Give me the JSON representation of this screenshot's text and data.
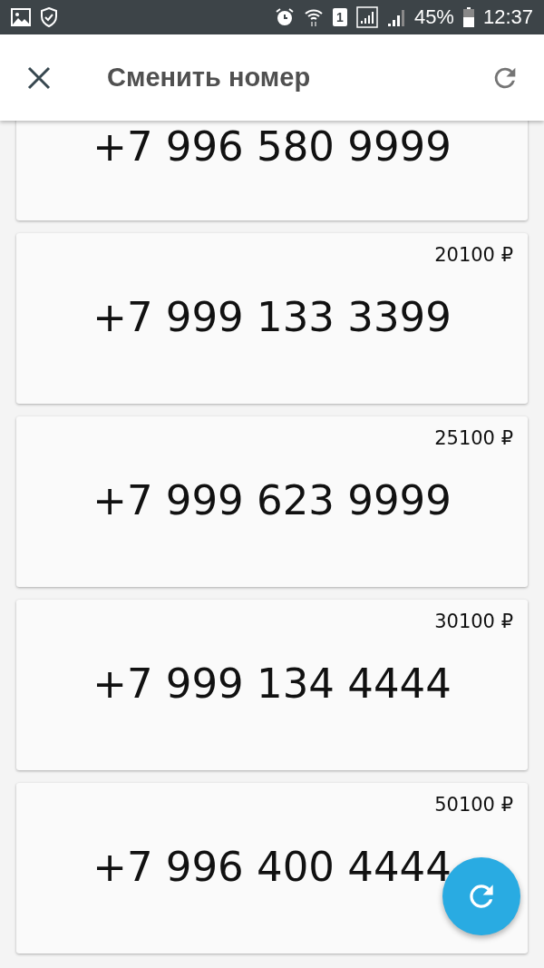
{
  "status_bar": {
    "sim_slot": "1",
    "battery": "45%",
    "time": "12:37"
  },
  "header": {
    "title": "Сменить номер"
  },
  "numbers": [
    {
      "number": "+7 996 580 9999"
    },
    {
      "price": "20100 ₽",
      "number": "+7 999 133 3399"
    },
    {
      "price": "25100 ₽",
      "number": "+7 999 623 9999"
    },
    {
      "price": "30100 ₽",
      "number": "+7 999 134 4444"
    },
    {
      "price": "50100 ₽",
      "number": "+7 996 400 4444"
    }
  ]
}
